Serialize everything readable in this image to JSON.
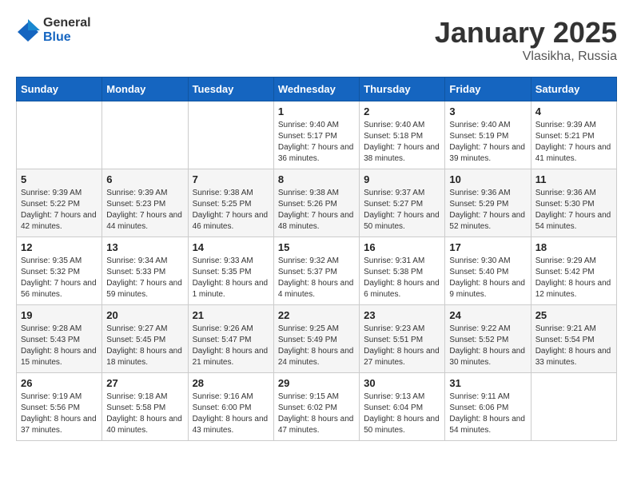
{
  "logo": {
    "general": "General",
    "blue": "Blue"
  },
  "title": "January 2025",
  "location": "Vlasikha, Russia",
  "days_header": [
    "Sunday",
    "Monday",
    "Tuesday",
    "Wednesday",
    "Thursday",
    "Friday",
    "Saturday"
  ],
  "weeks": [
    [
      {
        "day": "",
        "sunrise": "",
        "sunset": "",
        "daylight": ""
      },
      {
        "day": "",
        "sunrise": "",
        "sunset": "",
        "daylight": ""
      },
      {
        "day": "",
        "sunrise": "",
        "sunset": "",
        "daylight": ""
      },
      {
        "day": "1",
        "sunrise": "Sunrise: 9:40 AM",
        "sunset": "Sunset: 5:17 PM",
        "daylight": "Daylight: 7 hours and 36 minutes."
      },
      {
        "day": "2",
        "sunrise": "Sunrise: 9:40 AM",
        "sunset": "Sunset: 5:18 PM",
        "daylight": "Daylight: 7 hours and 38 minutes."
      },
      {
        "day": "3",
        "sunrise": "Sunrise: 9:40 AM",
        "sunset": "Sunset: 5:19 PM",
        "daylight": "Daylight: 7 hours and 39 minutes."
      },
      {
        "day": "4",
        "sunrise": "Sunrise: 9:39 AM",
        "sunset": "Sunset: 5:21 PM",
        "daylight": "Daylight: 7 hours and 41 minutes."
      }
    ],
    [
      {
        "day": "5",
        "sunrise": "Sunrise: 9:39 AM",
        "sunset": "Sunset: 5:22 PM",
        "daylight": "Daylight: 7 hours and 42 minutes."
      },
      {
        "day": "6",
        "sunrise": "Sunrise: 9:39 AM",
        "sunset": "Sunset: 5:23 PM",
        "daylight": "Daylight: 7 hours and 44 minutes."
      },
      {
        "day": "7",
        "sunrise": "Sunrise: 9:38 AM",
        "sunset": "Sunset: 5:25 PM",
        "daylight": "Daylight: 7 hours and 46 minutes."
      },
      {
        "day": "8",
        "sunrise": "Sunrise: 9:38 AM",
        "sunset": "Sunset: 5:26 PM",
        "daylight": "Daylight: 7 hours and 48 minutes."
      },
      {
        "day": "9",
        "sunrise": "Sunrise: 9:37 AM",
        "sunset": "Sunset: 5:27 PM",
        "daylight": "Daylight: 7 hours and 50 minutes."
      },
      {
        "day": "10",
        "sunrise": "Sunrise: 9:36 AM",
        "sunset": "Sunset: 5:29 PM",
        "daylight": "Daylight: 7 hours and 52 minutes."
      },
      {
        "day": "11",
        "sunrise": "Sunrise: 9:36 AM",
        "sunset": "Sunset: 5:30 PM",
        "daylight": "Daylight: 7 hours and 54 minutes."
      }
    ],
    [
      {
        "day": "12",
        "sunrise": "Sunrise: 9:35 AM",
        "sunset": "Sunset: 5:32 PM",
        "daylight": "Daylight: 7 hours and 56 minutes."
      },
      {
        "day": "13",
        "sunrise": "Sunrise: 9:34 AM",
        "sunset": "Sunset: 5:33 PM",
        "daylight": "Daylight: 7 hours and 59 minutes."
      },
      {
        "day": "14",
        "sunrise": "Sunrise: 9:33 AM",
        "sunset": "Sunset: 5:35 PM",
        "daylight": "Daylight: 8 hours and 1 minute."
      },
      {
        "day": "15",
        "sunrise": "Sunrise: 9:32 AM",
        "sunset": "Sunset: 5:37 PM",
        "daylight": "Daylight: 8 hours and 4 minutes."
      },
      {
        "day": "16",
        "sunrise": "Sunrise: 9:31 AM",
        "sunset": "Sunset: 5:38 PM",
        "daylight": "Daylight: 8 hours and 6 minutes."
      },
      {
        "day": "17",
        "sunrise": "Sunrise: 9:30 AM",
        "sunset": "Sunset: 5:40 PM",
        "daylight": "Daylight: 8 hours and 9 minutes."
      },
      {
        "day": "18",
        "sunrise": "Sunrise: 9:29 AM",
        "sunset": "Sunset: 5:42 PM",
        "daylight": "Daylight: 8 hours and 12 minutes."
      }
    ],
    [
      {
        "day": "19",
        "sunrise": "Sunrise: 9:28 AM",
        "sunset": "Sunset: 5:43 PM",
        "daylight": "Daylight: 8 hours and 15 minutes."
      },
      {
        "day": "20",
        "sunrise": "Sunrise: 9:27 AM",
        "sunset": "Sunset: 5:45 PM",
        "daylight": "Daylight: 8 hours and 18 minutes."
      },
      {
        "day": "21",
        "sunrise": "Sunrise: 9:26 AM",
        "sunset": "Sunset: 5:47 PM",
        "daylight": "Daylight: 8 hours and 21 minutes."
      },
      {
        "day": "22",
        "sunrise": "Sunrise: 9:25 AM",
        "sunset": "Sunset: 5:49 PM",
        "daylight": "Daylight: 8 hours and 24 minutes."
      },
      {
        "day": "23",
        "sunrise": "Sunrise: 9:23 AM",
        "sunset": "Sunset: 5:51 PM",
        "daylight": "Daylight: 8 hours and 27 minutes."
      },
      {
        "day": "24",
        "sunrise": "Sunrise: 9:22 AM",
        "sunset": "Sunset: 5:52 PM",
        "daylight": "Daylight: 8 hours and 30 minutes."
      },
      {
        "day": "25",
        "sunrise": "Sunrise: 9:21 AM",
        "sunset": "Sunset: 5:54 PM",
        "daylight": "Daylight: 8 hours and 33 minutes."
      }
    ],
    [
      {
        "day": "26",
        "sunrise": "Sunrise: 9:19 AM",
        "sunset": "Sunset: 5:56 PM",
        "daylight": "Daylight: 8 hours and 37 minutes."
      },
      {
        "day": "27",
        "sunrise": "Sunrise: 9:18 AM",
        "sunset": "Sunset: 5:58 PM",
        "daylight": "Daylight: 8 hours and 40 minutes."
      },
      {
        "day": "28",
        "sunrise": "Sunrise: 9:16 AM",
        "sunset": "Sunset: 6:00 PM",
        "daylight": "Daylight: 8 hours and 43 minutes."
      },
      {
        "day": "29",
        "sunrise": "Sunrise: 9:15 AM",
        "sunset": "Sunset: 6:02 PM",
        "daylight": "Daylight: 8 hours and 47 minutes."
      },
      {
        "day": "30",
        "sunrise": "Sunrise: 9:13 AM",
        "sunset": "Sunset: 6:04 PM",
        "daylight": "Daylight: 8 hours and 50 minutes."
      },
      {
        "day": "31",
        "sunrise": "Sunrise: 9:11 AM",
        "sunset": "Sunset: 6:06 PM",
        "daylight": "Daylight: 8 hours and 54 minutes."
      },
      {
        "day": "",
        "sunrise": "",
        "sunset": "",
        "daylight": ""
      }
    ]
  ]
}
